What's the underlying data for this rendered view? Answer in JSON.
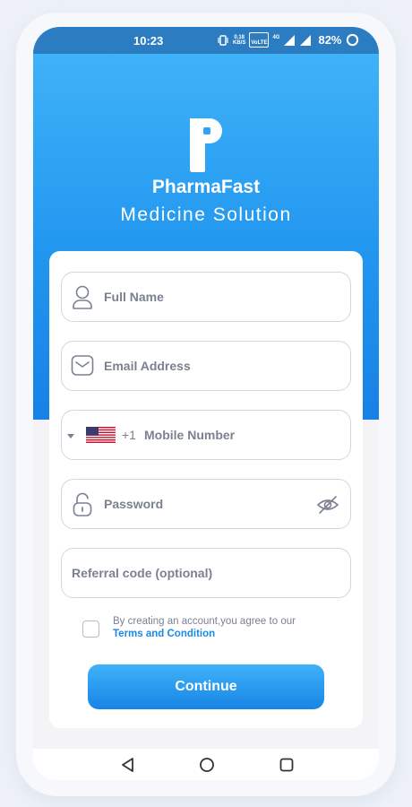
{
  "status_bar": {
    "time": "10:23",
    "net_speed_value": "0.18",
    "net_speed_unit": "KB/S",
    "volte": "VoLTE",
    "network_type": "4G",
    "battery": "82%"
  },
  "brand": {
    "name": "PharmaFast",
    "tagline": "Medicine Solution",
    "colors": {
      "primary": "#2196ef",
      "primary_light": "#3fb2f8",
      "link": "#1a8ae6"
    }
  },
  "form": {
    "full_name": {
      "placeholder": "Full Name",
      "icon": "user-icon"
    },
    "email": {
      "placeholder": "Email Address",
      "icon": "mail-icon"
    },
    "mobile": {
      "country_flag": "us-flag-icon",
      "dial_code": "+1",
      "placeholder": "Mobile Number"
    },
    "password": {
      "placeholder": "Password",
      "icon": "lock-icon",
      "toggle_icon": "eye-off-icon"
    },
    "referral": {
      "placeholder": "Referral code (optional)"
    }
  },
  "consent": {
    "text": "By creating an account,you agree to our",
    "link": "Terms and Condition"
  },
  "actions": {
    "continue_label": "Continue"
  },
  "nav": {
    "back": "back-icon",
    "home": "home-icon",
    "recents": "recents-icon"
  }
}
